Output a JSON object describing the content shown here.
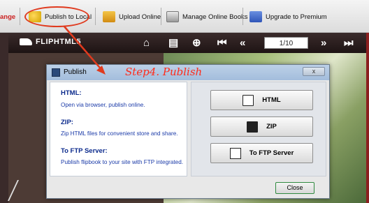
{
  "toolbar": {
    "partial_label": "ange",
    "items": [
      {
        "label": "Publish to Local",
        "icon": "publish-local-icon"
      },
      {
        "label": "Upload Online",
        "icon": "upload-online-icon"
      },
      {
        "label": "Manage Online Books",
        "icon": "manage-books-icon"
      },
      {
        "label": "Upgrade to Premium",
        "icon": "cart-icon"
      }
    ]
  },
  "viewer": {
    "logo_text": "FLIPHTML5",
    "page_indicator": "1/10",
    "icons": [
      "home-icon",
      "print-icon",
      "zoom-icon",
      "first-page-icon",
      "prev-page-icon",
      "next-page-icon",
      "last-page-icon"
    ]
  },
  "annotation": {
    "step_text": "Step4. Publish"
  },
  "dialog": {
    "title": "Publish",
    "close_x": "x",
    "sections": [
      {
        "title": "HTML:",
        "desc": "Open via browser, publish online."
      },
      {
        "title": "ZIP:",
        "desc": "Zip HTML files for convenient store and share."
      },
      {
        "title": "To FTP Server:",
        "desc": "Publish flipbook to your site with FTP integrated."
      }
    ],
    "buttons": [
      {
        "label": "HTML",
        "icon": "html-file-icon"
      },
      {
        "label": "ZIP",
        "icon": "zip-icon"
      },
      {
        "label": "To FTP Server",
        "icon": "ftp-server-icon"
      }
    ],
    "close_label": "Close"
  },
  "colors": {
    "accent_red": "#e03a1e",
    "section_title": "#0b2a8c",
    "section_desc": "#1a3aa8",
    "viewer_bar": "#2a1c1c"
  }
}
